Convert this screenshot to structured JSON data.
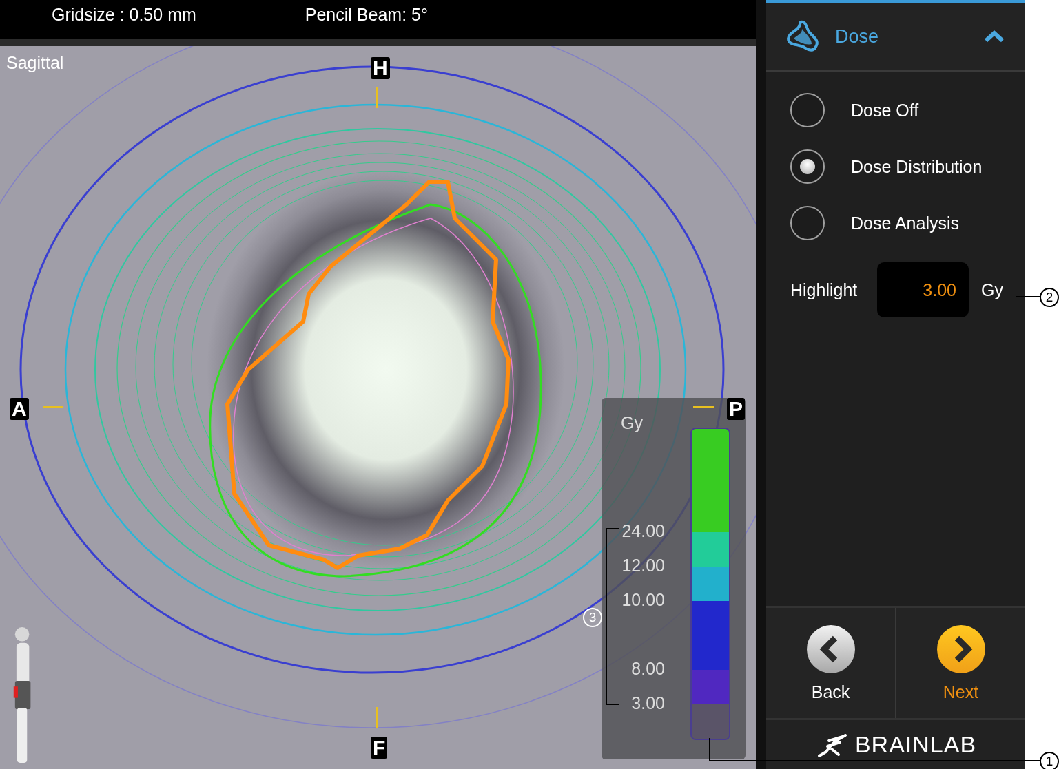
{
  "viewer": {
    "info": [
      "Gridsize : 0.50 mm",
      "Pencil Beam: 5°"
    ],
    "view_name": "Sagittal",
    "orientation": [
      {
        "kind": "top",
        "label": "H"
      },
      {
        "kind": "left",
        "label": "A"
      },
      {
        "kind": "right",
        "label": "P"
      },
      {
        "kind": "bottom",
        "label": "F"
      }
    ],
    "legend": {
      "unit": "Gy",
      "bands": [
        {
          "color": "#38cc22",
          "label": "24.00"
        },
        {
          "color": "#22cc99",
          "label": "12.00"
        },
        {
          "color": "#22b0cc",
          "label": "10.00"
        },
        {
          "color": "#2228cc",
          "label": "8.00"
        },
        {
          "color": "#5028c0",
          "label": "3.00"
        },
        {
          "color": "#5a5468"
        }
      ]
    }
  },
  "panel": {
    "section": {
      "title": "Dose",
      "expanded": true
    },
    "options": [
      {
        "label": "Dose Off",
        "selected": false
      },
      {
        "label": "Dose Distribution",
        "selected": true
      },
      {
        "label": "Dose Analysis",
        "selected": false
      }
    ],
    "highlight": {
      "label": "Highlight",
      "value": "3.00",
      "unit": "Gy"
    },
    "buttons": [
      {
        "kind": "back",
        "label": "Back"
      },
      {
        "kind": "next",
        "label": "Next"
      }
    ],
    "logo": "BRAINLAB"
  },
  "callouts": [
    {
      "kind": "colorbar",
      "label": "1"
    },
    {
      "kind": "highlight",
      "label": "2"
    },
    {
      "kind": "range",
      "label": "3"
    }
  ]
}
